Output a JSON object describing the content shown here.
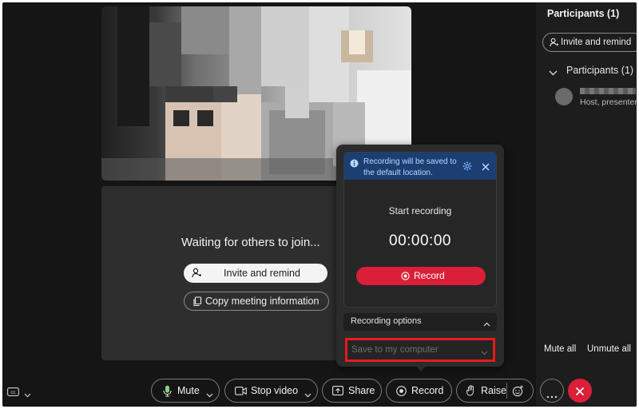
{
  "waiting": {
    "message": "Waiting for others to join...",
    "invite_label": "Invite and remind",
    "copy_label": "Copy meeting information"
  },
  "sidebar": {
    "title": "Participants (1)",
    "invite_label": "Invite and remind",
    "group_label": "Participants (1)",
    "participant_role": "Host, presenter",
    "mute_all": "Mute all",
    "unmute_all": "Unmute all"
  },
  "recording": {
    "info_text": "Recording will be saved to the default location.",
    "start_label": "Start recording",
    "timer": "00:00:00",
    "record_label": "Record",
    "options_label": "Recording options",
    "save_location": "Save to my computer"
  },
  "toolbar": {
    "mute": "Mute",
    "stop_video": "Stop video",
    "share": "Share",
    "record": "Record",
    "raise": "Raise"
  },
  "colors": {
    "accent_red": "#db1f38",
    "highlight_red": "#e41b1b",
    "info_banner": "#1b3f73",
    "background": "#151515"
  }
}
